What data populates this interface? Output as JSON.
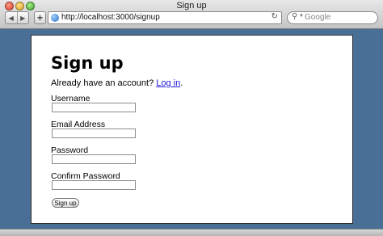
{
  "window": {
    "title": "Sign up"
  },
  "toolbar": {
    "back_icon": "back-arrow-icon",
    "forward_icon": "forward-arrow-icon",
    "add_label": "+",
    "url": "http://localhost:3000/signup",
    "reload_icon": "reload-icon",
    "search_placeholder": "Google"
  },
  "page": {
    "heading": "Sign up",
    "account_prompt": "Already have an account?",
    "login_link": "Log in",
    "login_suffix": ".",
    "fields": [
      {
        "label": "Username",
        "value": ""
      },
      {
        "label": "Email Address",
        "value": ""
      },
      {
        "label": "Password",
        "value": ""
      },
      {
        "label": "Confirm Password",
        "value": ""
      }
    ],
    "submit_label": "Sign up"
  },
  "colors": {
    "background": "#4a6f96",
    "link": "#1a16d8"
  }
}
